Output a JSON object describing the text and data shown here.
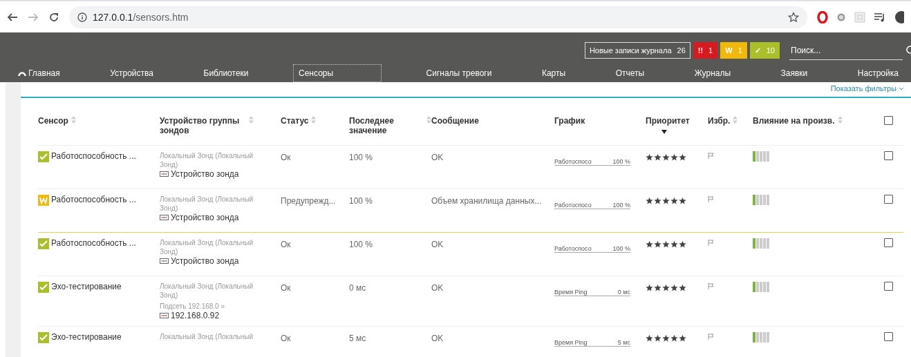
{
  "browser": {
    "url_host": "127.0.0.1",
    "url_path": "/sensors.htm"
  },
  "topbar": {
    "log_label": "Новые записи журнала",
    "log_count": "26",
    "search_placeholder": "Поиск...",
    "status_counts": [
      {
        "glyph": "!!",
        "count": "1",
        "color": "#d71920"
      },
      {
        "glyph": "W",
        "count": "1",
        "color": "#f0b90b"
      },
      {
        "glyph": "✓",
        "count": "10",
        "color": "#aabf2a"
      }
    ]
  },
  "nav": [
    {
      "label": "Главная",
      "selected": false,
      "icon": true
    },
    {
      "label": "Устройства",
      "selected": false
    },
    {
      "label": "Библиотеки",
      "selected": false
    },
    {
      "label": "Сенсоры",
      "selected": true
    },
    {
      "label": "Сигналы тревоги",
      "selected": false
    },
    {
      "label": "Карты",
      "selected": false
    },
    {
      "label": "Отчеты",
      "selected": false
    },
    {
      "label": "Журналы",
      "selected": false
    },
    {
      "label": "Заявки",
      "selected": false
    },
    {
      "label": "Настройка",
      "selected": false
    }
  ],
  "filters_link": "Показать фильтры",
  "table": {
    "columns": [
      {
        "label": "Сенсор",
        "sortable": true,
        "sorted_desc": false
      },
      {
        "label": "Устройство группы зондов",
        "sortable": true,
        "sorted_desc": false
      },
      {
        "label": "Статус",
        "sortable": true,
        "sorted_desc": false
      },
      {
        "label": "Последнее значение",
        "sortable": true,
        "sorted_desc": false
      },
      {
        "label": "Сообщение",
        "sortable": false,
        "sorted_desc": false
      },
      {
        "label": "График",
        "sortable": false,
        "sorted_desc": false
      },
      {
        "label": "Приоритет",
        "sortable": false,
        "sorted_desc": true
      },
      {
        "label": "Избр.",
        "sortable": true,
        "sorted_desc": false
      },
      {
        "label": "Влияние на произв.",
        "sortable": true,
        "sorted_desc": false
      },
      {
        "kind": "checkbox",
        "checked": false
      }
    ],
    "rows": [
      {
        "kind": "ok",
        "sensor": "Работоспособность ...",
        "probe": "Локальный Зонд (Локальный Зонд)",
        "device": "Устройство зонда",
        "status": "Ок",
        "last_value": "100 %",
        "message": "OK",
        "graph_label": "Работоспосо",
        "graph_value": "100 %",
        "stars": 5,
        "impact": {
          "level": 0.2
        },
        "checked": false
      },
      {
        "kind": "warning",
        "sensor": "Работоспособность ...",
        "probe": "Локальный Зонд (Локальный Зонд)",
        "device": "Устройство зонда",
        "status": "Предупрежд...",
        "last_value": "100 %",
        "message": "Объем хранилища данных...",
        "graph_label": "Работоспосо",
        "graph_value": "100 %",
        "stars": 5,
        "impact": {
          "level": 0.2
        },
        "checked": false
      },
      {
        "kind": "ok",
        "sensor": "Работоспособность ...",
        "probe": "Локальный Зонд (Локальный Зонд)",
        "device": "Устройство зонда",
        "status": "Ок",
        "last_value": "100 %",
        "message": "OK",
        "graph_label": "Работоспосо",
        "graph_value": "100 %",
        "stars": 5,
        "impact": {
          "level": 0.2
        },
        "checked": false
      },
      {
        "kind": "ok",
        "sensor": "Эхо-тестирование",
        "probe": "Локальный Зонд (Локальный Зонд)",
        "subnet": "Подсеть 192.168.0 »",
        "device": "192.168.0.92",
        "status": "Ок",
        "last_value": "0 мс",
        "message": "OK",
        "graph_label": "Время Ping",
        "graph_value": "0 мс",
        "stars": 5,
        "impact": {
          "level": 0.2
        },
        "checked": false
      },
      {
        "kind": "ok",
        "sensor": "Эхо-тестирование",
        "probe": "Локальный Зонд (Локальный",
        "status": "Ок",
        "last_value": "5 мс",
        "message": "OK",
        "graph_label": "Время Ping",
        "graph_value": "5 мс",
        "stars": 5,
        "impact": {
          "level": 0.2
        },
        "checked": false
      }
    ]
  }
}
